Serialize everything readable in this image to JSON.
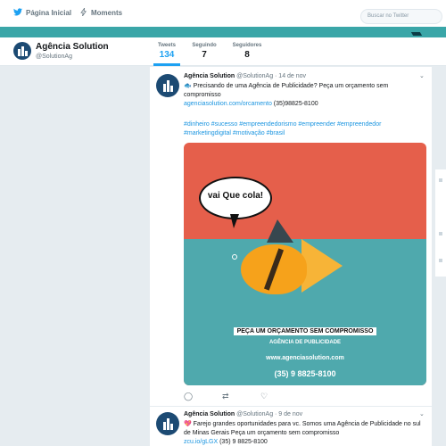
{
  "nav": {
    "home": "Página Inicial",
    "moments": "Moments",
    "search_placeholder": "Buscar no Twitter"
  },
  "profile": {
    "name": "Agência Solution",
    "handle": "@SolutionAg"
  },
  "stats": [
    {
      "label": "Tweets",
      "value": "134"
    },
    {
      "label": "Seguindo",
      "value": "7"
    },
    {
      "label": "Seguidores",
      "value": "8"
    }
  ],
  "tweets": [
    {
      "name": "Agência Solution",
      "meta": "@SolutionAg · 14 de nov",
      "text": "🐟 Precisando de uma Agência de Publicidade? Peça um orçamento sem compromisso",
      "link": "agenciasolution.com/orcamento",
      "phone": "(35)98825-8100",
      "tags": "#dinheiro #sucesso #empreendedorismo #empreender #empreendedor #marketingdigital #motivação #brasil",
      "image": {
        "bubble": "vai Que cola!",
        "line1": "PEÇA UM ORÇAMENTO SEM COMPROMISSO",
        "line2": "AGÊNCIA DE PUBLICIDADE",
        "line3": "www.agenciasolution.com",
        "line4": "(35) 9 8825-8100"
      }
    },
    {
      "name": "Agência Solution",
      "meta": "@SolutionAg · 9 de nov",
      "text": "💖 Farejo grandes oportunidades para vc. Somos uma Agência de Publicidade no sul de Minas Gerais Peça um orçamento sem compromisso",
      "link": "zcu.io/gLGX",
      "phone": "(35) 9 8825-8100"
    }
  ],
  "colors": {
    "accent": "#1da1f2",
    "banner": "#3aa6a8",
    "ad_red": "#e55f4b",
    "ad_water": "#4fa9ad"
  }
}
